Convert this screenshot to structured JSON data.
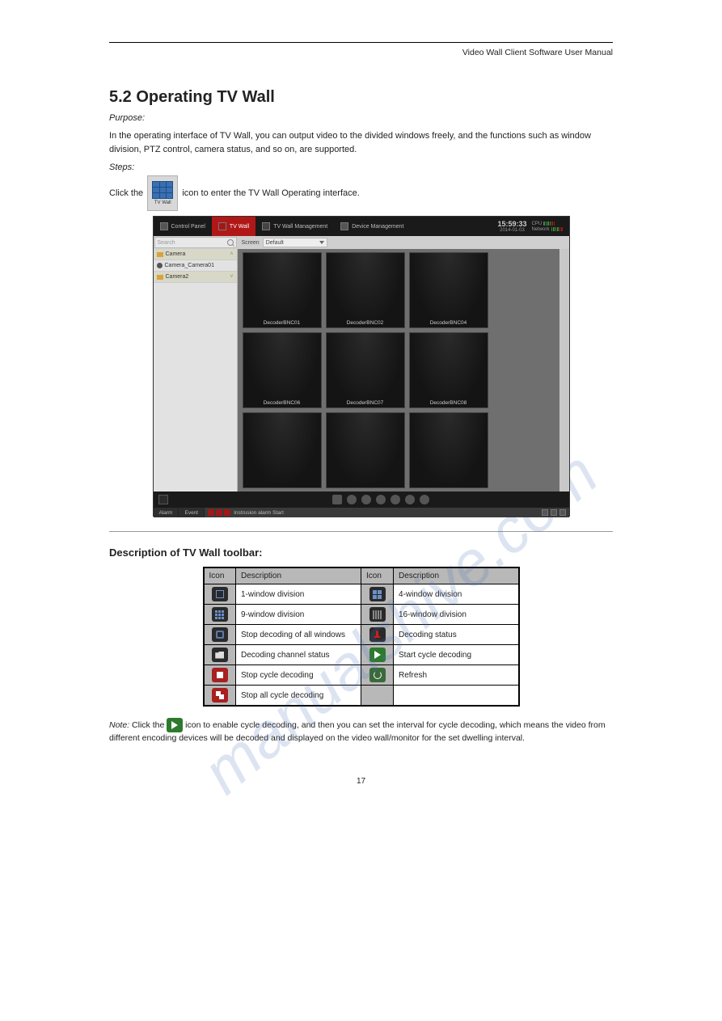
{
  "header": {
    "title": "Video Wall Client Software User Manual"
  },
  "section": {
    "num_title": "5.2 Operating TV Wall",
    "purpose_lbl": "Purpose:",
    "body": "In the operating interface of TV Wall, you can output video to the divided windows freely, and the functions such as window division, PTZ control, camera status, and so on, are supported.",
    "steps_lbl": "Steps:",
    "step1_pre": "Click the ",
    "step1_post": " icon to enter the TV Wall Operating interface.",
    "icon_label": "TV Wall"
  },
  "screenshot": {
    "tabs": {
      "control": "Control Panel",
      "tvwall": "TV Wall",
      "tvwall_mgmt": "TV Wall Management",
      "device_mgmt": "Device Management"
    },
    "clock": {
      "time": "15:59:33",
      "date": "2014-01-03"
    },
    "meters": {
      "cpu": "CPU",
      "net": "Network"
    },
    "search_placeholder": "Search",
    "screen_lbl": "Screen",
    "screen_value": "Default",
    "sidebar": {
      "camera": "Camera",
      "cam1": "Camera_Camera01",
      "cam2": "Camera2"
    },
    "tiles": [
      "DecoderBNC01",
      "DecoderBNC02",
      "DecoderBNC04",
      "DecoderBNC06",
      "DecoderBNC07",
      "DecoderBNC08",
      "",
      "",
      ""
    ],
    "status": {
      "alarm": "Alarm",
      "event": "Event",
      "msg": "Instrusion alarm Start"
    }
  },
  "subhead": "Description of TV Wall toolbar:",
  "table": {
    "h_icon": "Icon",
    "h_desc": "Description",
    "rows": [
      {
        "d1": "1-window division",
        "d2": "4-window division"
      },
      {
        "d1": "9-window division",
        "d2": "16-window division"
      },
      {
        "d1": "Stop decoding of all windows",
        "d2": "Decoding status"
      },
      {
        "d1": "Decoding channel status",
        "d2": "Start cycle decoding"
      },
      {
        "d1": "Stop cycle decoding",
        "d2": "Refresh"
      },
      {
        "d1": "Stop all cycle decoding",
        "d2": ""
      }
    ]
  },
  "notes": {
    "n_lbl": "Note:",
    "n1_pre": " Click the ",
    "n1_post": " icon to enable cycle decoding, and then you can set the interval for cycle decoding, which means the video from different encoding devices will be decoded and displayed on the video wall/monitor for the set dwelling interval."
  },
  "pgnum": "17",
  "watermark": "manualshive.com"
}
